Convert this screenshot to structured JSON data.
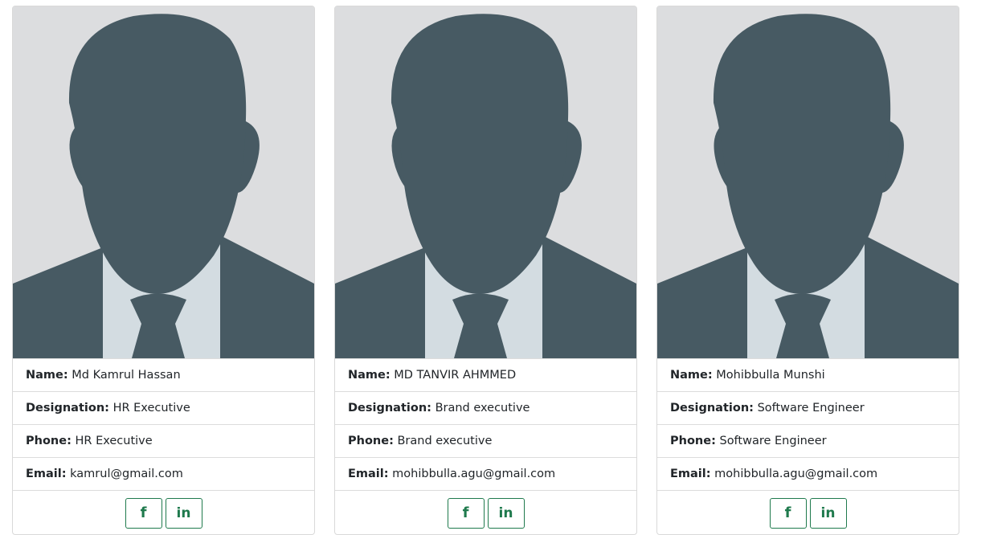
{
  "colors": {
    "silhouette": "#475a63",
    "photo_bg": "#dcdddf",
    "shirt": "#d3dce1",
    "button_accent": "#1f7a4d"
  },
  "labels": {
    "name": "Name:",
    "designation": "Designation:",
    "phone": "Phone:",
    "email": "Email:"
  },
  "social_icons": {
    "facebook_glyph": "f",
    "linkedin_glyph": "in"
  },
  "cards": [
    {
      "name": "Md Kamrul Hassan",
      "designation": "HR Executive",
      "phone": "HR Executive",
      "email": "kamrul@gmail.com"
    },
    {
      "name": "MD TANVIR AHMMED",
      "designation": "Brand executive",
      "phone": "Brand executive",
      "email": "mohibbulla.agu@gmail.com"
    },
    {
      "name": "Mohibbulla Munshi",
      "designation": "Software Engineer",
      "phone": "Software Engineer",
      "email": "mohibbulla.agu@gmail.com"
    }
  ]
}
